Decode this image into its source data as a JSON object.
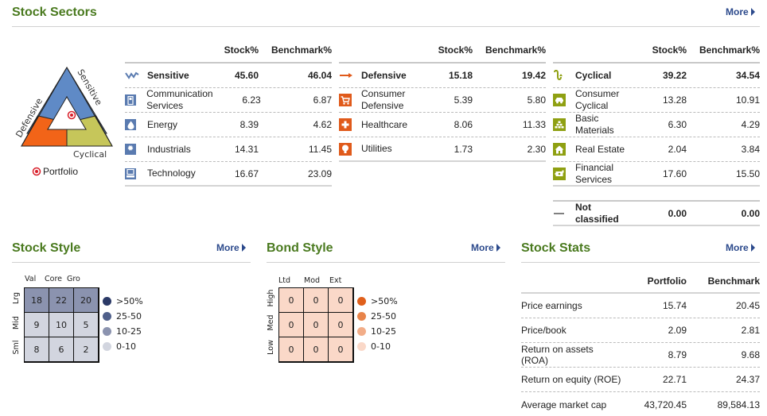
{
  "sectors": {
    "title": "Stock Sectors",
    "more": "More",
    "col_stock": "Stock%",
    "col_bench": "Benchmark%",
    "triangle": {
      "labels": {
        "sensitive": "Sensitive",
        "defensive": "Defensive",
        "cyclical": "Cyclical"
      },
      "legend": "Portfolio",
      "colors": {
        "sensitive": "#5f8ac6",
        "defensive": "#f26418",
        "cyclical": "#c6c65a",
        "marker": "#d81f2a"
      }
    },
    "groups": [
      {
        "name": "Sensitive",
        "icon": "sensitive-icon",
        "stock": "45.60",
        "bench": "46.04",
        "items": [
          {
            "name": "Communication Services",
            "icon": "phone-icon",
            "stock": "6.23",
            "bench": "6.87"
          },
          {
            "name": "Energy",
            "icon": "flame-icon",
            "stock": "8.39",
            "bench": "4.62"
          },
          {
            "name": "Industrials",
            "icon": "gear-icon",
            "stock": "14.31",
            "bench": "11.45"
          },
          {
            "name": "Technology",
            "icon": "computer-icon",
            "stock": "16.67",
            "bench": "23.09"
          }
        ]
      },
      {
        "name": "Defensive",
        "icon": "defensive-icon",
        "stock": "15.18",
        "bench": "19.42",
        "items": [
          {
            "name": "Consumer Defensive",
            "icon": "cart-icon",
            "stock": "5.39",
            "bench": "5.80"
          },
          {
            "name": "Healthcare",
            "icon": "cross-icon",
            "stock": "8.06",
            "bench": "11.33"
          },
          {
            "name": "Utilities",
            "icon": "lightbulb-icon",
            "stock": "1.73",
            "bench": "2.30"
          }
        ]
      },
      {
        "name": "Cyclical",
        "icon": "cyclical-icon",
        "stock": "39.22",
        "bench": "34.54",
        "items": [
          {
            "name": "Consumer Cyclical",
            "icon": "car-icon",
            "stock": "13.28",
            "bench": "10.91"
          },
          {
            "name": "Basic Materials",
            "icon": "bricks-icon",
            "stock": "6.30",
            "bench": "4.29"
          },
          {
            "name": "Real Estate",
            "icon": "house-icon",
            "stock": "2.04",
            "bench": "3.84"
          },
          {
            "name": "Financial Services",
            "icon": "money-icon",
            "stock": "17.60",
            "bench": "15.50"
          }
        ]
      }
    ],
    "not_classified": {
      "name": "Not classified",
      "stock": "0.00",
      "bench": "0.00"
    }
  },
  "stock_style": {
    "title": "Stock Style",
    "more": "More",
    "cols": [
      "Val",
      "Core",
      "Gro"
    ],
    "rows": [
      "Lrg",
      "Mid",
      "Sml"
    ],
    "values": [
      [
        18,
        22,
        20
      ],
      [
        9,
        10,
        5
      ],
      [
        8,
        6,
        2
      ]
    ],
    "legend": [
      {
        "label": ">50%",
        "color": "#2b3a67"
      },
      {
        "label": "25-50",
        "color": "#4f5f8a"
      },
      {
        "label": "10-25",
        "color": "#8b93af"
      },
      {
        "label": "0-10",
        "color": "#d2d5df"
      }
    ]
  },
  "bond_style": {
    "title": "Bond Style",
    "more": "More",
    "cols": [
      "Ltd",
      "Mod",
      "Ext"
    ],
    "rows": [
      "High",
      "Med",
      "Low"
    ],
    "values": [
      [
        0,
        0,
        0
      ],
      [
        0,
        0,
        0
      ],
      [
        0,
        0,
        0
      ]
    ],
    "legend": [
      {
        "label": ">50%",
        "color": "#e0601c"
      },
      {
        "label": "25-50",
        "color": "#e8844a"
      },
      {
        "label": "10-25",
        "color": "#f2ad88"
      },
      {
        "label": "0-10",
        "color": "#fad8c8"
      }
    ]
  },
  "stock_stats": {
    "title": "Stock Stats",
    "more": "More",
    "col_portfolio": "Portfolio",
    "col_bench": "Benchmark",
    "rows": [
      {
        "name": "Price earnings",
        "portfolio": "15.74",
        "bench": "20.45"
      },
      {
        "name": "Price/book",
        "portfolio": "2.09",
        "bench": "2.81"
      },
      {
        "name": "Return on assets (ROA)",
        "portfolio": "8.79",
        "bench": "9.68"
      },
      {
        "name": "Return on equity (ROE)",
        "portfolio": "22.71",
        "bench": "24.37"
      },
      {
        "name": "Average market cap",
        "portfolio": "43,720.45",
        "bench": "89,584.13"
      }
    ]
  }
}
